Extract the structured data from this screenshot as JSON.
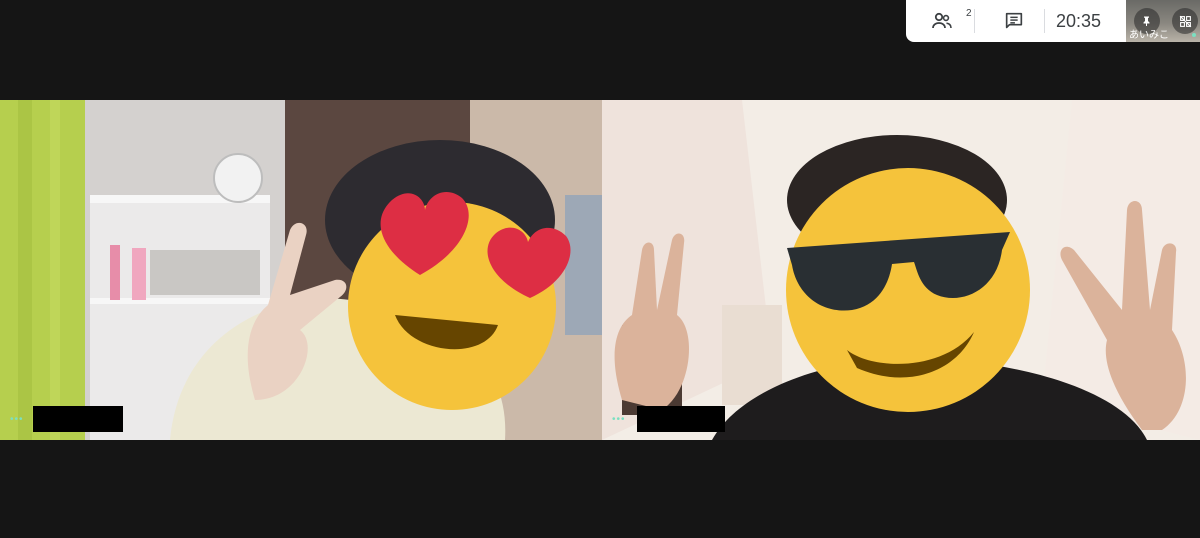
{
  "toolbar": {
    "participants_count": "2",
    "clock": "20:35",
    "self_view_name": "あいみこ"
  },
  "participants": [
    {
      "name": "",
      "dots": "•••"
    },
    {
      "name": "",
      "dots": "•••"
    }
  ],
  "colors": {
    "background": "#151515",
    "toolbar_bg": "#ffffff",
    "speaking_dots": "#7be0c1",
    "emoji_yellow": "#f5c33b",
    "heart_red": "#dd2e44"
  }
}
